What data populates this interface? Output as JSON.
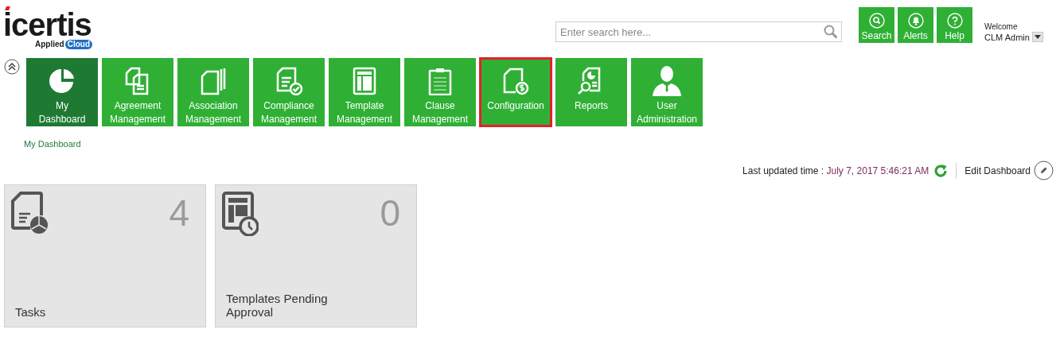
{
  "logo": {
    "brand": "icertis",
    "tagline": "Applied",
    "badge": "Cloud"
  },
  "search": {
    "placeholder": "Enter search here..."
  },
  "header_buttons": [
    {
      "label": "Search"
    },
    {
      "label": "Alerts"
    },
    {
      "label": "Help"
    }
  ],
  "user": {
    "greeting": "Welcome",
    "name": "CLM Admin"
  },
  "nav_tiles": [
    {
      "line1": "My",
      "line2": "Dashboard",
      "selected": true,
      "highlighted": false
    },
    {
      "line1": "Agreement",
      "line2": "Management",
      "selected": false,
      "highlighted": false
    },
    {
      "line1": "Association",
      "line2": "Management",
      "selected": false,
      "highlighted": false
    },
    {
      "line1": "Compliance",
      "line2": "Management",
      "selected": false,
      "highlighted": false
    },
    {
      "line1": "Template",
      "line2": "Management",
      "selected": false,
      "highlighted": false
    },
    {
      "line1": "Clause",
      "line2": "Management",
      "selected": false,
      "highlighted": false
    },
    {
      "line1": "Configuration",
      "selected": false,
      "highlighted": true
    },
    {
      "line1": "Reports",
      "selected": false,
      "highlighted": false
    },
    {
      "line1": "User",
      "line2": "Administration",
      "selected": false,
      "highlighted": false
    }
  ],
  "breadcrumb": "My Dashboard",
  "last_updated": {
    "label": "Last updated time :",
    "value": "July 7, 2017 5:46:21 AM"
  },
  "edit_dashboard": "Edit Dashboard",
  "cards": [
    {
      "count": "4",
      "title": "Tasks"
    },
    {
      "count": "0",
      "title": "Templates Pending Approval"
    }
  ]
}
